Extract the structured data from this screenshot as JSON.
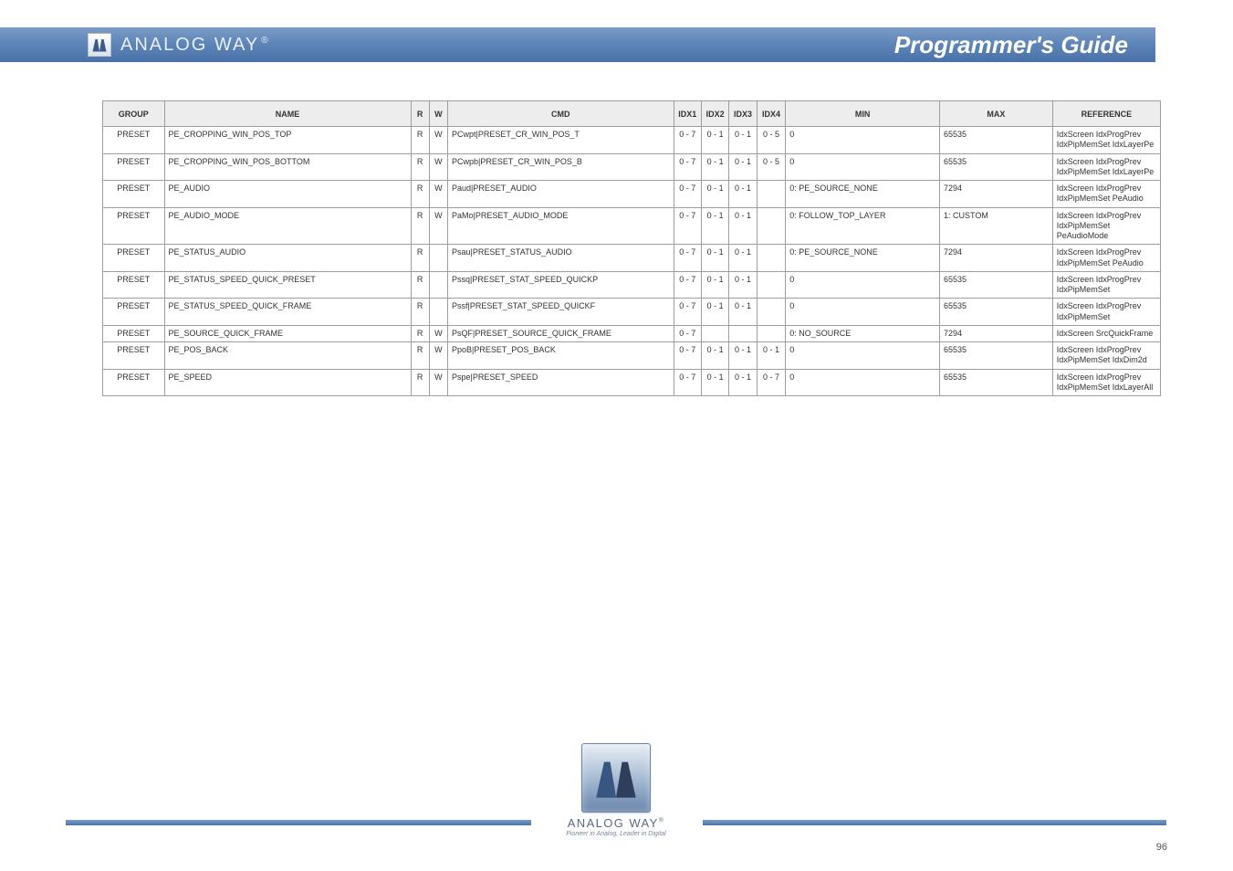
{
  "header": {
    "brand": "ANALOG WAY",
    "brand_sup": "®",
    "title": "Programmer's Guide"
  },
  "table": {
    "headers": {
      "group": "GROUP",
      "name": "NAME",
      "r": "R",
      "w": "W",
      "cmd": "CMD",
      "i1": "IDX1",
      "i2": "IDX2",
      "i3": "IDX3",
      "i4": "IDX4",
      "min": "MIN",
      "max": "MAX",
      "ref": "REFERENCE"
    },
    "rows": [
      {
        "group": "PRESET",
        "name": "PE_CROPPING_WIN_POS_TOP",
        "r": "R",
        "w": "W",
        "cmd": "PCwpt|PRESET_CR_WIN_POS_T",
        "i1": "0 - 7",
        "i2": "0 - 1",
        "i3": "0 - 1",
        "i4": "0 - 5",
        "min": "0",
        "max": "65535",
        "ref": "IdxScreen IdxProgPrev IdxPipMemSet IdxLayerPe"
      },
      {
        "group": "PRESET",
        "name": "PE_CROPPING_WIN_POS_BOTTOM",
        "r": "R",
        "w": "W",
        "cmd": "PCwpb|PRESET_CR_WIN_POS_B",
        "i1": "0 - 7",
        "i2": "0 - 1",
        "i3": "0 - 1",
        "i4": "0 - 5",
        "min": "0",
        "max": "65535",
        "ref": "IdxScreen IdxProgPrev IdxPipMemSet IdxLayerPe"
      },
      {
        "group": "PRESET",
        "name": "PE_AUDIO",
        "r": "R",
        "w": "W",
        "cmd": "Paud|PRESET_AUDIO",
        "i1": "0 - 7",
        "i2": "0 - 1",
        "i3": "0 - 1",
        "i4": "",
        "min": "0: PE_SOURCE_NONE",
        "max": "7294",
        "ref": "IdxScreen IdxProgPrev IdxPipMemSet PeAudio"
      },
      {
        "group": "PRESET",
        "name": "PE_AUDIO_MODE",
        "r": "R",
        "w": "W",
        "cmd": "PaMo|PRESET_AUDIO_MODE",
        "i1": "0 - 7",
        "i2": "0 - 1",
        "i3": "0 - 1",
        "i4": "",
        "min": "0: FOLLOW_TOP_LAYER",
        "max": "1: CUSTOM",
        "ref": "IdxScreen IdxProgPrev IdxPipMemSet PeAudioMode"
      },
      {
        "group": "PRESET",
        "name": "PE_STATUS_AUDIO",
        "r": "R",
        "w": "",
        "cmd": "Psau|PRESET_STATUS_AUDIO",
        "i1": "0 - 7",
        "i2": "0 - 1",
        "i3": "0 - 1",
        "i4": "",
        "min": "0: PE_SOURCE_NONE",
        "max": "7294",
        "ref": "IdxScreen IdxProgPrev IdxPipMemSet PeAudio"
      },
      {
        "group": "PRESET",
        "name": "PE_STATUS_SPEED_QUICK_PRESET",
        "r": "R",
        "w": "",
        "cmd": "Pssq|PRESET_STAT_SPEED_QUICKP",
        "i1": "0 - 7",
        "i2": "0 - 1",
        "i3": "0 - 1",
        "i4": "",
        "min": "0",
        "max": "65535",
        "ref": "IdxScreen IdxProgPrev IdxPipMemSet"
      },
      {
        "group": "PRESET",
        "name": "PE_STATUS_SPEED_QUICK_FRAME",
        "r": "R",
        "w": "",
        "cmd": "Pssf|PRESET_STAT_SPEED_QUICKF",
        "i1": "0 - 7",
        "i2": "0 - 1",
        "i3": "0 - 1",
        "i4": "",
        "min": "0",
        "max": "65535",
        "ref": "IdxScreen IdxProgPrev IdxPipMemSet"
      },
      {
        "group": "PRESET",
        "name": "PE_SOURCE_QUICK_FRAME",
        "r": "R",
        "w": "W",
        "cmd": "PsQF|PRESET_SOURCE_QUICK_FRAME",
        "i1": "0 - 7",
        "i2": "",
        "i3": "",
        "i4": "",
        "min": "0: NO_SOURCE",
        "max": "7294",
        "ref": "IdxScreen SrcQuickFrame"
      },
      {
        "group": "PRESET",
        "name": "PE_POS_BACK",
        "r": "R",
        "w": "W",
        "cmd": "PpoB|PRESET_POS_BACK",
        "i1": "0 - 7",
        "i2": "0 - 1",
        "i3": "0 - 1",
        "i4": "0 - 1",
        "min": "0",
        "max": "65535",
        "ref": "IdxScreen IdxProgPrev IdxPipMemSet IdxDim2d"
      },
      {
        "group": "PRESET",
        "name": "PE_SPEED",
        "r": "R",
        "w": "W",
        "cmd": "Pspe|PRESET_SPEED",
        "i1": "0 - 7",
        "i2": "0 - 1",
        "i3": "0 - 1",
        "i4": "0 - 7",
        "min": "0",
        "max": "65535",
        "ref": "IdxScreen IdxProgPrev IdxPipMemSet IdxLayerAll"
      }
    ]
  },
  "footer": {
    "brand": "ANALOG WAY",
    "brand_sup": "®",
    "tagline": "Pioneer in Analog, Leader in Digital",
    "page": "96"
  }
}
